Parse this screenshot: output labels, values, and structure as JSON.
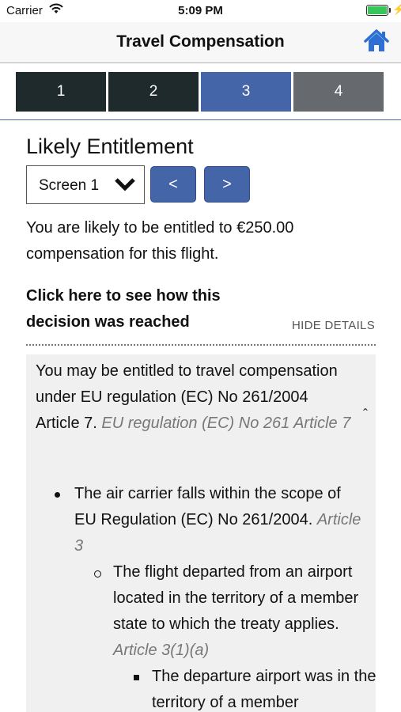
{
  "status_bar": {
    "carrier": "Carrier",
    "time": "5:09 PM"
  },
  "header": {
    "title": "Travel Compensation",
    "home_icon": "home-icon"
  },
  "steps": [
    {
      "label": "1",
      "state": "done"
    },
    {
      "label": "2",
      "state": "done"
    },
    {
      "label": "3",
      "state": "active"
    },
    {
      "label": "4",
      "state": "pending"
    }
  ],
  "main": {
    "heading": "Likely Entitlement",
    "screen_select": {
      "value": "Screen 1"
    },
    "prev_label": "<",
    "next_label": ">",
    "result_text": "You are likely to be entitled to €250.00 compensation for this flight.",
    "decision_link": "Click here to see how this decision was reached",
    "hide_details": "HIDE DETAILS"
  },
  "details": {
    "intro": "You may be entitled to travel compensation under EU regulation (EC) No 261/2004 Article 7.",
    "intro_ref": "EU regulation (EC) No 261 Article 7",
    "caret": "ˆ",
    "level1": {
      "text": "The air carrier falls within the scope of EU Regulation (EC) No 261/2004.",
      "ref": "Article 3"
    },
    "level2": {
      "text": "The flight departed from an airport located in the territory of a member state to which the treaty applies.",
      "ref": "Article 3(1)(a)"
    },
    "level3": {
      "text": "The departure airport was in the territory of a member"
    }
  },
  "colors": {
    "accent": "#4465a8",
    "step_dark": "#1e2a2b",
    "step_pending": "#666a6e",
    "battery": "#35c759",
    "panel_bg": "#f0f0f0"
  }
}
